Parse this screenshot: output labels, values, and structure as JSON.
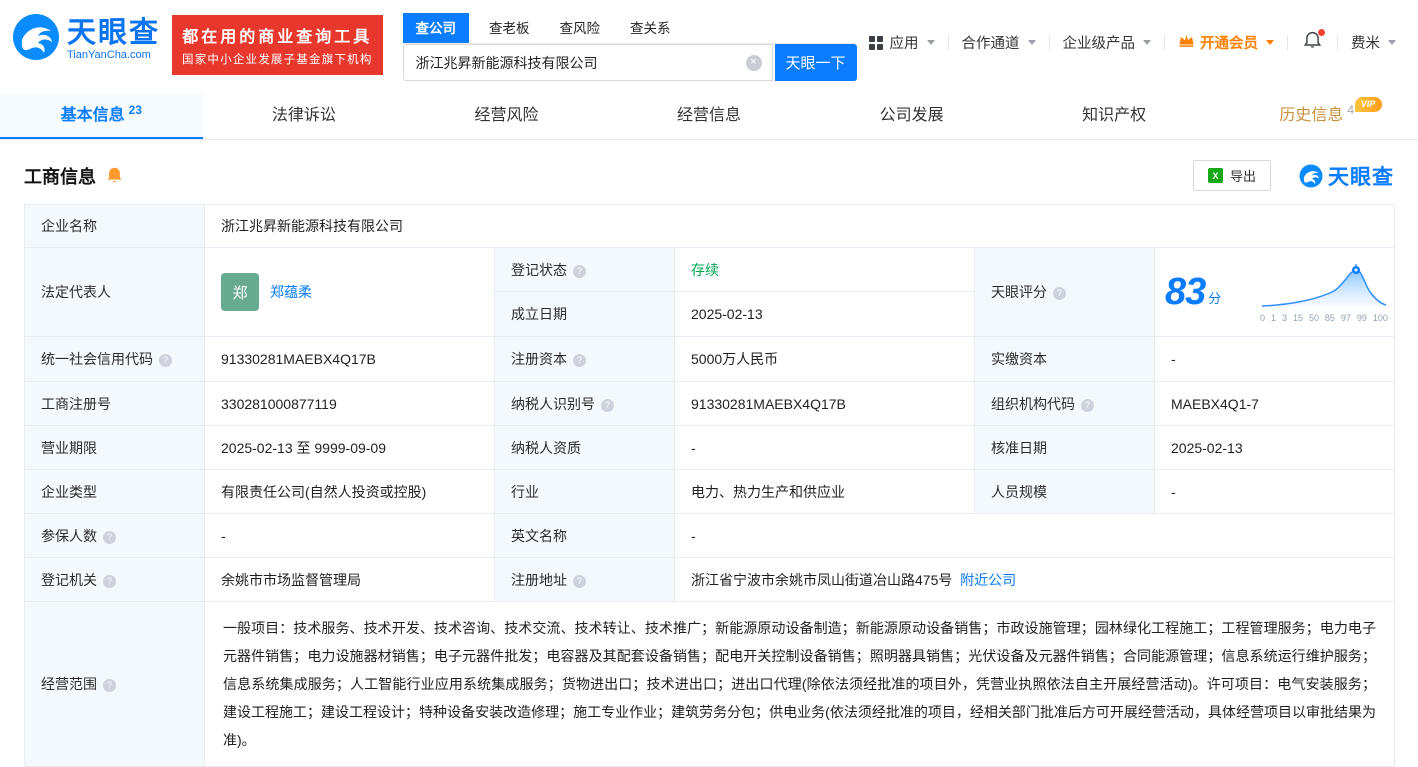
{
  "colors": {
    "accent_blue": "#0a7cff",
    "brand_red": "#e8382d",
    "status_green": "#00a854",
    "vip_orange": "#ff8000",
    "history_tab_gold": "#c9923f"
  },
  "header": {
    "brand": {
      "name": "天眼查",
      "domain": "TianYanCha.com"
    },
    "slogan": {
      "line1": "都在用的商业查询工具",
      "line2": "国家中小企业发展子基金旗下机构"
    },
    "search": {
      "tabs": [
        {
          "label": "查公司"
        },
        {
          "label": "查老板"
        },
        {
          "label": "查风险"
        },
        {
          "label": "查关系"
        }
      ],
      "value": "浙江兆昇新能源科技有限公司",
      "button": "天眼一下"
    },
    "nav": {
      "apps": "应用",
      "partner": "合作通道",
      "enterprise": "企业级产品",
      "vip": "开通会员",
      "user": "费米"
    }
  },
  "tabs": [
    {
      "label": "基本信息",
      "count": "23"
    },
    {
      "label": "法律诉讼"
    },
    {
      "label": "经营风险"
    },
    {
      "label": "经营信息"
    },
    {
      "label": "公司发展"
    },
    {
      "label": "知识产权"
    },
    {
      "label": "历史信息",
      "count": "4",
      "badge": "VIP"
    }
  ],
  "section": {
    "title": "工商信息",
    "export_label": "导出",
    "logo_text": "天眼查"
  },
  "fields": {
    "company_name": {
      "label": "企业名称",
      "value": "浙江兆昇新能源科技有限公司"
    },
    "legal_rep": {
      "label": "法定代表人",
      "avatar": "郑",
      "value": "郑蕴柔"
    },
    "reg_status": {
      "label": "登记状态",
      "value": "存续"
    },
    "establish_date": {
      "label": "成立日期",
      "value": "2025-02-13"
    },
    "score": {
      "label": "天眼评分",
      "value": "83",
      "unit": "分",
      "axis": [
        "0",
        "1",
        "3",
        "15",
        "50",
        "85",
        "97",
        "99",
        "100"
      ]
    },
    "credit_code": {
      "label": "统一社会信用代码",
      "value": "91330281MAEBX4Q17B"
    },
    "reg_capital": {
      "label": "注册资本",
      "value": "5000万人民币"
    },
    "paid_capital": {
      "label": "实缴资本",
      "value": "-"
    },
    "reg_number": {
      "label": "工商注册号",
      "value": "330281000877119"
    },
    "taxpayer_id": {
      "label": "纳税人识别号",
      "value": "91330281MAEBX4Q17B"
    },
    "org_code": {
      "label": "组织机构代码",
      "value": "MAEBX4Q1-7"
    },
    "business_term": {
      "label": "营业期限",
      "value": "2025-02-13 至 9999-09-09"
    },
    "taxpayer_quality": {
      "label": "纳税人资质",
      "value": "-"
    },
    "approval_date": {
      "label": "核准日期",
      "value": "2025-02-13"
    },
    "company_type": {
      "label": "企业类型",
      "value": "有限责任公司(自然人投资或控股)"
    },
    "industry": {
      "label": "行业",
      "value": "电力、热力生产和供应业"
    },
    "staff_size": {
      "label": "人员规模",
      "value": "-"
    },
    "insured_count": {
      "label": "参保人数",
      "value": "-"
    },
    "english_name": {
      "label": "英文名称",
      "value": "-"
    },
    "reg_authority": {
      "label": "登记机关",
      "value": "余姚市市场监督管理局"
    },
    "reg_address": {
      "label": "注册地址",
      "value": "浙江省宁波市余姚市凤山街道冶山路475号",
      "link": "附近公司"
    },
    "business_scope": {
      "label": "经营范围",
      "value": "一般项目：技术服务、技术开发、技术咨询、技术交流、技术转让、技术推广；新能源原动设备制造；新能源原动设备销售；市政设施管理；园林绿化工程施工；工程管理服务；电力电子元器件销售；电力设施器材销售；电子元器件批发；电容器及其配套设备销售；配电开关控制设备销售；照明器具销售；光伏设备及元器件销售；合同能源管理；信息系统运行维护服务；信息系统集成服务；人工智能行业应用系统集成服务；货物进出口；技术进出口；进出口代理(除依法须经批准的项目外，凭营业执照依法自主开展经营活动)。许可项目：电气安装服务；建设工程施工；建设工程设计；特种设备安装改造修理；施工专业作业；建筑劳务分包；供电业务(依法须经批准的项目，经相关部门批准后方可开展经营活动，具体经营项目以审批结果为准)。"
    }
  }
}
